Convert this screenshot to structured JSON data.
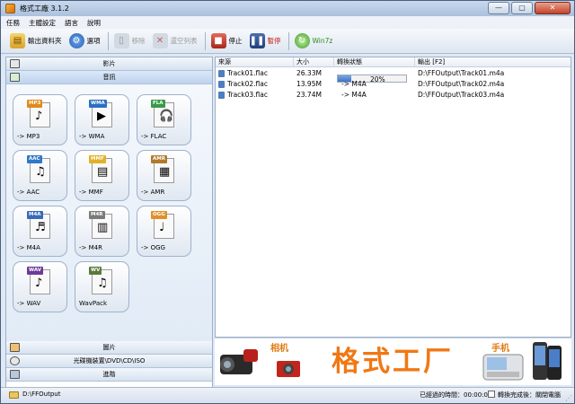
{
  "app": {
    "title": "格式工廠 3.1.2",
    "controls": [
      "—",
      "▢",
      "✕"
    ]
  },
  "menu": [
    "任務",
    "主體設定",
    "語言",
    "說明"
  ],
  "toolbar": {
    "output_folder": "輸出資料夾",
    "options": "選項",
    "remove": "移除",
    "clear_list": "還空列表",
    "stop": "停止",
    "pause": "暫停",
    "win7z": "Win7z"
  },
  "categories": {
    "video": "影片",
    "audio": "音訊",
    "picture": "圖片",
    "rom": "光碟機裝置\\DVD\\CD\\ISO",
    "advanced": "進階"
  },
  "tiles": [
    {
      "badge": "MP3",
      "label": "-> MP3",
      "color": "#e08a1c",
      "glyph": "♪"
    },
    {
      "badge": "WMA",
      "label": "-> WMA",
      "color": "#2a6fc2",
      "glyph": "▶"
    },
    {
      "badge": "FLA",
      "label": "-> FLAC",
      "color": "#3a9a4a",
      "glyph": "🎧"
    },
    {
      "badge": "AAC",
      "label": "-> AAC",
      "color": "#2f78c8",
      "glyph": "♫"
    },
    {
      "badge": "MMF",
      "label": "-> MMF",
      "color": "#e0b227",
      "glyph": "▤"
    },
    {
      "badge": "AMR",
      "label": "-> AMR",
      "color": "#b07a2a",
      "glyph": "▦"
    },
    {
      "badge": "M4A",
      "label": "-> M4A",
      "color": "#3a6ab8",
      "glyph": "♬"
    },
    {
      "badge": "M4R",
      "label": "-> M4R",
      "color": "#7a7a7a",
      "glyph": "▥"
    },
    {
      "badge": "OGG",
      "label": "-> OGG",
      "color": "#e0902a",
      "glyph": "♩"
    },
    {
      "badge": "WAV",
      "label": "-> WAV",
      "color": "#6a3a9a",
      "glyph": "♪"
    },
    {
      "badge": "WV",
      "label": "WavPack",
      "color": "#5a7a3a",
      "glyph": "♫"
    }
  ],
  "table": {
    "headers": [
      "來源",
      "大小",
      "轉換狀態",
      "輸出 [F2]"
    ],
    "rows": [
      {
        "source": "Track01.flac",
        "size": "26.33M",
        "status": "20%",
        "progress": 0.2,
        "output": "D:\\FFOutput\\Track01.m4a"
      },
      {
        "source": "Track02.flac",
        "size": "13.95M",
        "status": "-> M4A",
        "progress": null,
        "output": "D:\\FFOutput\\Track02.m4a"
      },
      {
        "source": "Track03.flac",
        "size": "23.74M",
        "status": "-> M4A",
        "progress": null,
        "output": "D:\\FFOutput\\Track03.m4a"
      }
    ]
  },
  "banner": {
    "camera_label": "相机",
    "brand": "格式工厂",
    "phone_label": "手机"
  },
  "status": {
    "path": "D:\\FFOutput",
    "elapsed": "已經過的時間：00:00:08",
    "after_label": "轉換完成後：關閉電腦"
  }
}
